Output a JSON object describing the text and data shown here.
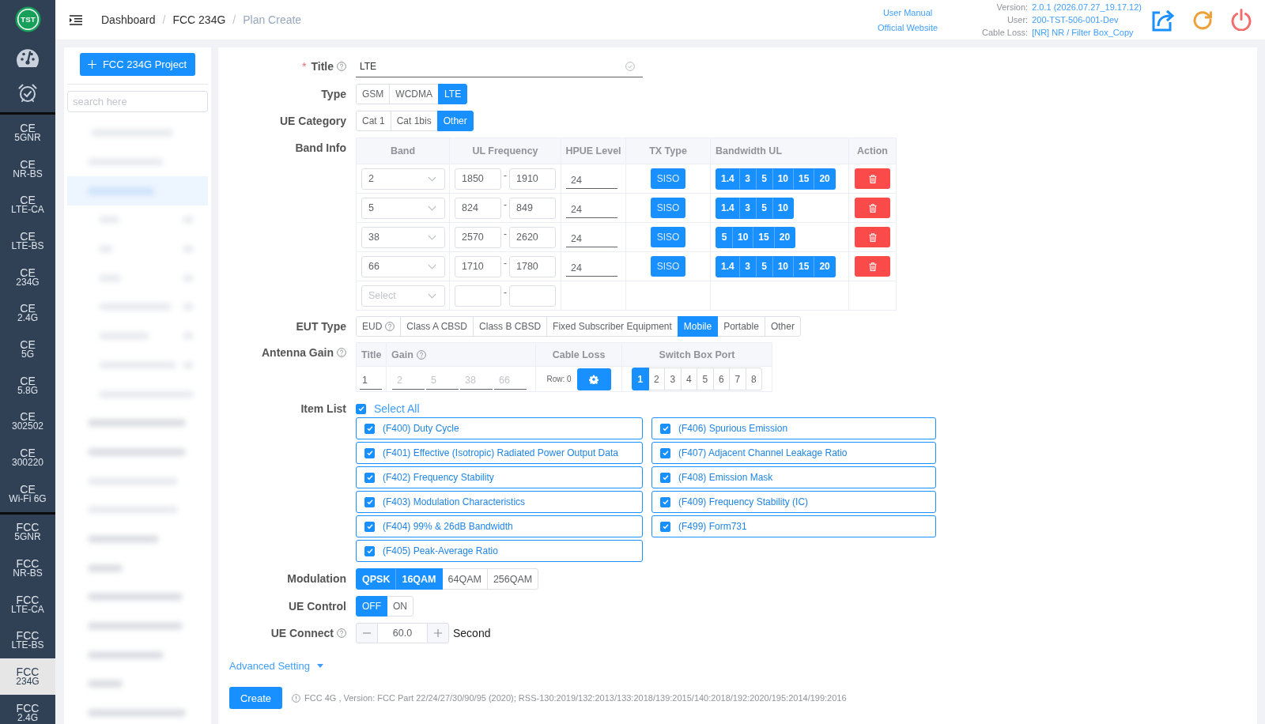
{
  "sidebar": {
    "logo_text": "TST",
    "groups": [
      {
        "items": [
          {
            "line1": "CE",
            "line2": "5GNR",
            "selected": false
          },
          {
            "line1": "CE",
            "line2": "NR-BS",
            "selected": false
          },
          {
            "line1": "CE",
            "line2": "LTE-CA",
            "selected": false
          },
          {
            "line1": "CE",
            "line2": "LTE-BS",
            "selected": false
          },
          {
            "line1": "CE",
            "line2": "234G",
            "selected": false
          },
          {
            "line1": "CE",
            "line2": "2.4G",
            "selected": false
          },
          {
            "line1": "CE",
            "line2": "5G",
            "selected": false
          },
          {
            "line1": "CE",
            "line2": "5.8G",
            "selected": false
          },
          {
            "line1": "CE",
            "line2": "302502",
            "selected": false
          },
          {
            "line1": "CE",
            "line2": "300220",
            "selected": false
          },
          {
            "line1": "CE",
            "line2": "Wi-Fi 6G",
            "selected": false
          }
        ]
      },
      {
        "items": [
          {
            "line1": "FCC",
            "line2": "5GNR",
            "selected": false
          },
          {
            "line1": "FCC",
            "line2": "NR-BS",
            "selected": false
          },
          {
            "line1": "FCC",
            "line2": "LTE-CA",
            "selected": false
          },
          {
            "line1": "FCC",
            "line2": "LTE-BS",
            "selected": false
          },
          {
            "line1": "FCC",
            "line2": "234G",
            "selected": true
          },
          {
            "line1": "FCC",
            "line2": "2.4G",
            "selected": false
          }
        ]
      }
    ]
  },
  "header": {
    "breadcrumb": {
      "separator": "/",
      "items": [
        "Dashboard",
        "FCC 234G",
        "Plan Create"
      ]
    },
    "links": [
      "User Manual",
      "Official Website"
    ],
    "info": [
      {
        "label": "Version:",
        "value": "2.0.1 (2026.07.27_19.17.12)"
      },
      {
        "label": "User:",
        "value": "200-TST-506-001-Dev"
      },
      {
        "label": "Cable Loss:",
        "value": "[NR] NR / Filter Box_Copy"
      }
    ]
  },
  "project_panel": {
    "new_project_button": "FCC 234G Project",
    "search": {
      "placeholder": "search here"
    }
  },
  "form": {
    "title": {
      "required_mark": "*",
      "label": "Title",
      "help": true,
      "value": "LTE",
      "valid": true
    },
    "type": {
      "label": "Type",
      "options": [
        {
          "label": "GSM",
          "selected": false
        },
        {
          "label": "WCDMA",
          "selected": false
        },
        {
          "label": "LTE",
          "selected": true
        }
      ]
    },
    "ue_category": {
      "label": "UE Category",
      "options": [
        {
          "label": "Cat 1",
          "selected": false
        },
        {
          "label": "Cat 1bis",
          "selected": false
        },
        {
          "label": "Other",
          "selected": true
        }
      ]
    },
    "band_info": {
      "label": "Band Info",
      "columns": [
        "Band",
        "UL Frequency",
        "HPUE Level",
        "TX Type",
        "Bandwidth UL",
        "Action"
      ],
      "range_separator": "-",
      "rows": [
        {
          "band": "2",
          "ul_from": "1850",
          "ul_to": "1910",
          "hpue": "24",
          "tx_type": "SISO",
          "bandwidths": [
            {
              "label": "1.4",
              "selected": true
            },
            {
              "label": "3",
              "selected": true
            },
            {
              "label": "5",
              "selected": true
            },
            {
              "label": "10",
              "selected": true
            },
            {
              "label": "15",
              "selected": true
            },
            {
              "label": "20",
              "selected": true
            }
          ]
        },
        {
          "band": "5",
          "ul_from": "824",
          "ul_to": "849",
          "hpue": "24",
          "tx_type": "SISO",
          "bandwidths": [
            {
              "label": "1.4",
              "selected": true
            },
            {
              "label": "3",
              "selected": true
            },
            {
              "label": "5",
              "selected": true
            },
            {
              "label": "10",
              "selected": true
            }
          ]
        },
        {
          "band": "38",
          "ul_from": "2570",
          "ul_to": "2620",
          "hpue": "24",
          "tx_type": "SISO",
          "bandwidths": [
            {
              "label": "5",
              "selected": true
            },
            {
              "label": "10",
              "selected": true
            },
            {
              "label": "15",
              "selected": true
            },
            {
              "label": "20",
              "selected": true
            }
          ]
        },
        {
          "band": "66",
          "ul_from": "1710",
          "ul_to": "1780",
          "hpue": "24",
          "tx_type": "SISO",
          "bandwidths": [
            {
              "label": "1.4",
              "selected": true
            },
            {
              "label": "3",
              "selected": true
            },
            {
              "label": "5",
              "selected": true
            },
            {
              "label": "10",
              "selected": true
            },
            {
              "label": "15",
              "selected": true
            },
            {
              "label": "20",
              "selected": true
            }
          ]
        }
      ],
      "new_row": {
        "band_placeholder": "Select"
      }
    },
    "eut_type": {
      "label": "EUT Type",
      "options": [
        {
          "label": "EUD",
          "help": true,
          "selected": false
        },
        {
          "label": "Class A CBSD",
          "help": false,
          "selected": false
        },
        {
          "label": "Class B CBSD",
          "help": false,
          "selected": false
        },
        {
          "label": "Fixed Subscriber Equipment",
          "help": false,
          "selected": false
        },
        {
          "label": "Mobile",
          "help": false,
          "selected": true
        },
        {
          "label": "Portable",
          "help": false,
          "selected": false
        },
        {
          "label": "Other",
          "help": false,
          "selected": false
        }
      ]
    },
    "antenna_gain": {
      "label": "Antenna Gain",
      "help": true,
      "columns": [
        {
          "label": "Title",
          "help": false
        },
        {
          "label": "Gain",
          "help": true
        },
        {
          "label": "Cable Loss",
          "help": false
        },
        {
          "label": "Switch Box Port",
          "help": false
        }
      ],
      "title_value": "1",
      "gain_placeholders": [
        "2",
        "5",
        "38",
        "66"
      ],
      "cable_loss_row": "Row: 0",
      "ports": [
        {
          "label": "1",
          "selected": true
        },
        {
          "label": "2",
          "selected": false
        },
        {
          "label": "3",
          "selected": false
        },
        {
          "label": "4",
          "selected": false
        },
        {
          "label": "5",
          "selected": false
        },
        {
          "label": "6",
          "selected": false
        },
        {
          "label": "7",
          "selected": false
        },
        {
          "label": "8",
          "selected": false
        }
      ]
    },
    "item_list": {
      "label": "Item List",
      "select_all": {
        "label": "Select All",
        "checked": true
      },
      "items": [
        {
          "label": "(F400) Duty Cycle",
          "checked": true
        },
        {
          "label": "(F401) Effective (Isotropic) Radiated Power Output Data",
          "checked": true
        },
        {
          "label": "(F402) Frequency Stability",
          "checked": true
        },
        {
          "label": "(F403) Modulation Characteristics",
          "checked": true
        },
        {
          "label": "(F404) 99% & 26dB Bandwidth",
          "checked": true
        },
        {
          "label": "(F405) Peak-Average Ratio",
          "checked": true
        },
        {
          "label": "(F406) Spurious Emission",
          "checked": true
        },
        {
          "label": "(F407) Adjacent Channel Leakage Ratio",
          "checked": true
        },
        {
          "label": "(F408) Emission Mask",
          "checked": true
        },
        {
          "label": "(F409) Frequency Stability (IC)",
          "checked": true
        },
        {
          "label": "(F499) Form731",
          "checked": true
        }
      ]
    },
    "modulation": {
      "label": "Modulation",
      "options": [
        {
          "label": "QPSK",
          "selected": true
        },
        {
          "label": "16QAM",
          "selected": true
        },
        {
          "label": "64QAM",
          "selected": false
        },
        {
          "label": "256QAM",
          "selected": false
        }
      ]
    },
    "ue_control": {
      "label": "UE Control",
      "options": [
        {
          "label": "OFF",
          "selected": true
        },
        {
          "label": "ON",
          "selected": false
        }
      ]
    },
    "ue_connect": {
      "label": "UE Connect",
      "help": true,
      "value": "60.0",
      "unit": "Second"
    },
    "advanced_setting": {
      "label": "Advanced Setting",
      "expanded": false
    },
    "create_button": "Create",
    "footer_note": "FCC 4G , Version: FCC Part 22/24/27/30/90/95 (2020); RSS-130:2019/132:2013/133:2018/139:2015/140:2018/192:2020/195:2014/199:2016"
  }
}
